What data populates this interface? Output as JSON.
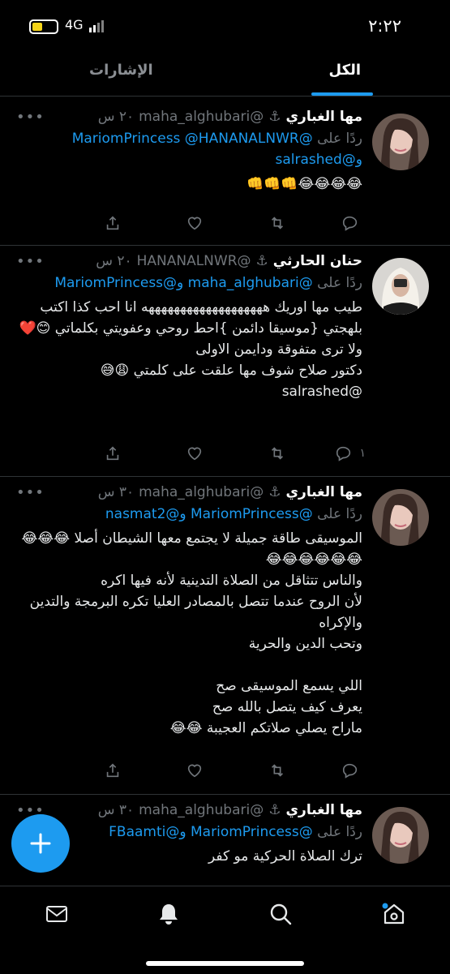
{
  "status": {
    "time": "٢:٢٢",
    "network": "4G"
  },
  "tabs": {
    "all": "الكل",
    "mentions": "الإشارات"
  },
  "tweets": [
    {
      "name": "مها الغباري",
      "handle": "@maha_alghubari",
      "time": "٢٠ س",
      "reply_prefix": "ردًا على",
      "reply_mentions": "@MariomPrincess @HANANALNWR",
      "reply_mentions2": "و@salrashed",
      "body": "😂😂😂😂👊👊👊",
      "reply_count": "",
      "avatar": "woman-portrait"
    },
    {
      "name": "حنان الحارثي",
      "handle": "@HANANALNWR",
      "time": "٢٠ س",
      "reply_prefix": "ردًا على",
      "reply_mentions": "@maha_alghubari و@MariomPrincess",
      "reply_mentions2": "",
      "body": "طيب مها اوريك هههههههههههههههههههه انا احب كذا اكتب بلهجتي {موسيقا دائمن }احط روحي وعفويتي بكلماتي 😊❤️ ولا ترى متفوقة ودايمن الاولى\nدكتور صلاح شوف مها علقت على كلمتي 😩😅",
      "trailing_mention": "@salrashed",
      "reply_count": "١",
      "avatar": "veiled-woman"
    },
    {
      "name": "مها الغباري",
      "handle": "@maha_alghubari",
      "time": "٣٠ س",
      "reply_prefix": "ردًا على",
      "reply_mentions": "@MariomPrincess و@nasmat2",
      "reply_mentions2": "",
      "body": "الموسيقى طاقة جميلة لا يجتمع معها الشيطان أصلا 😂😂😂😂😂😂😂😂😂\nوالناس تتثاقل من الصلاة التدينية لأنه فيها اكره\nلأن الروح عندما تتصل بالمصادر العليا تكره البرمجة والتدين والإكراه\nوتحب الدين والحرية\n\nاللي يسمع الموسيقى صح\nيعرف كيف يتصل بالله صح\nماراح يصلي صلاتكم العجيبة 😂😂",
      "reply_count": "",
      "avatar": "woman-portrait"
    },
    {
      "name": "مها الغباري",
      "handle": "@maha_alghubari",
      "time": "٣٠ س",
      "reply_prefix": "ردًا على",
      "reply_mentions": "@MariomPrincess و@FBaamti",
      "reply_mentions2": "",
      "body": "ترك الصلاة الحركية مو كفر",
      "reply_count": "",
      "avatar": "woman-portrait"
    }
  ],
  "icons": {
    "anchor": "⚓",
    "more": "•••",
    "fab": "plus-icon"
  },
  "colors": {
    "accent": "#1d9bf0",
    "background": "#000000",
    "muted": "#71767b"
  }
}
